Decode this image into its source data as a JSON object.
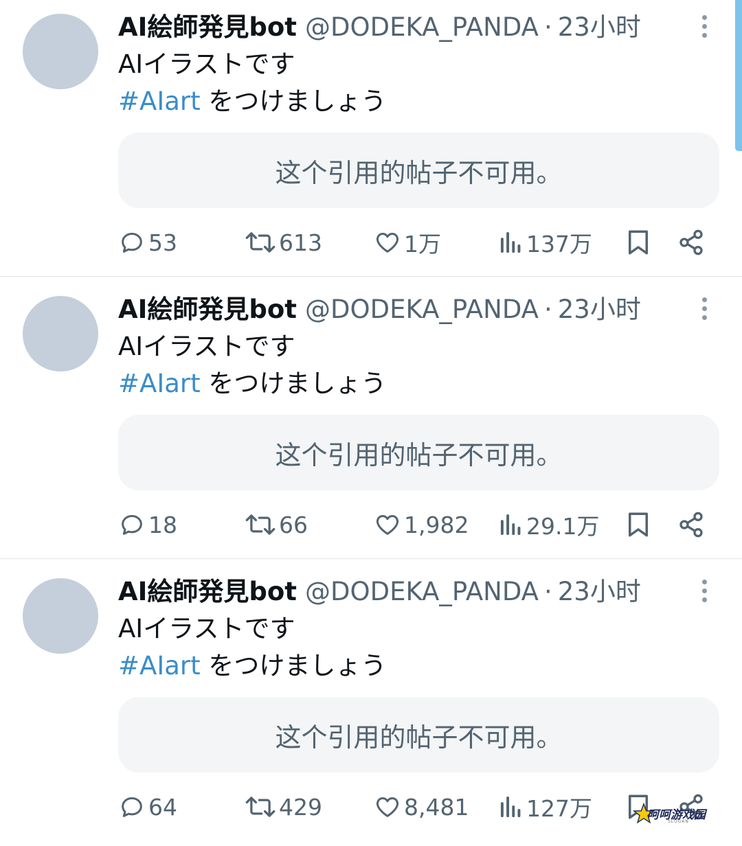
{
  "colors": {
    "hashtag": "#3a8dc9",
    "secondary_text": "#536471",
    "avatar_placeholder": "#c4cfdb",
    "quote_bg": "#f4f5f6",
    "scrollbar": "#7cc3ec"
  },
  "tweets": [
    {
      "author_name": "AI絵師発見bot",
      "handle": "@DODEKA_PANDA",
      "separator": "·",
      "time": "23小时",
      "line1": "AIイラストです",
      "hashtag": "#AIart",
      "line2_rest": " をつけましょう",
      "quote_text": "这个引用的帖子不可用。",
      "replies": "53",
      "retweets": "613",
      "likes": "1万",
      "views": "137万"
    },
    {
      "author_name": "AI絵師発見bot",
      "handle": "@DODEKA_PANDA",
      "separator": "·",
      "time": "23小时",
      "line1": "AIイラストです",
      "hashtag": "#AIart",
      "line2_rest": " をつけましょう",
      "quote_text": "这个引用的帖子不可用。",
      "replies": "18",
      "retweets": "66",
      "likes": "1,982",
      "views": "29.1万"
    },
    {
      "author_name": "AI絵師発見bot",
      "handle": "@DODEKA_PANDA",
      "separator": "·",
      "time": "23小时",
      "line1": "AIイラストです",
      "hashtag": "#AIart",
      "line2_rest": " をつけましょう",
      "quote_text": "这个引用的帖子不可用。",
      "replies": "64",
      "retweets": "429",
      "likes": "8,481",
      "views": "127万"
    }
  ],
  "icons": {
    "reply": "reply-icon",
    "retweet": "retweet-icon",
    "like": "heart-icon",
    "views": "views-icon",
    "bookmark": "bookmark-icon",
    "share": "share-icon",
    "more": "more-vertical-icon"
  },
  "watermark": {
    "text": "呵呵游戏园",
    "sub": "SLOGAN"
  }
}
